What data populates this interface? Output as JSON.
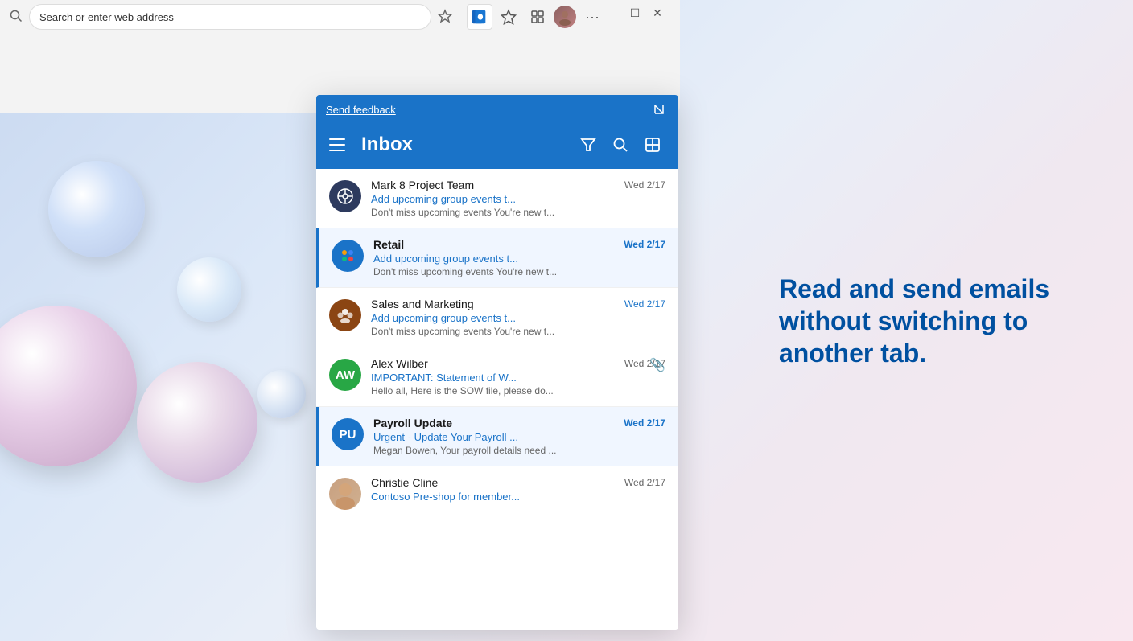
{
  "background": {
    "gradient": "linear-gradient(135deg, #c8d8f0, #dce8f8, #e8eef8, #f0e8f0, #f8e8f0)"
  },
  "browser": {
    "address_placeholder": "Search or enter web address",
    "window_controls": {
      "minimize": "—",
      "maximize": "☐",
      "close": "✕"
    }
  },
  "right_text": {
    "line1": "Read and send emails",
    "line2": "without switching to",
    "line3": "another tab."
  },
  "panel": {
    "feedback_label": "Send feedback",
    "title": "Inbox",
    "emails": [
      {
        "id": "mark8",
        "sender": "Mark 8 Project Team",
        "subject": "Add upcoming group events t...",
        "preview": "Don't miss upcoming events You're new t...",
        "date": "Wed 2/17",
        "avatar_initials": "",
        "avatar_class": "av-m8",
        "avatar_icon": "crosshair",
        "selected": false,
        "unread": false
      },
      {
        "id": "retail",
        "sender": "Retail",
        "subject": "Add upcoming group events t...",
        "preview": "Don't miss upcoming events You're new t...",
        "date": "Wed 2/17",
        "avatar_initials": "",
        "avatar_class": "av-retail",
        "avatar_icon": "dots-circle",
        "selected": true,
        "unread": true
      },
      {
        "id": "sales",
        "sender": "Sales and Marketing",
        "subject": "Add upcoming group events t...",
        "preview": "Don't miss upcoming events You're new t...",
        "date": "Wed 2/17",
        "avatar_initials": "",
        "avatar_class": "av-sm",
        "avatar_icon": "people",
        "selected": false,
        "unread": false
      },
      {
        "id": "alex",
        "sender": "Alex Wilber",
        "subject": "IMPORTANT: Statement of W...",
        "preview": "Hello all, Here is the SOW file, please do...",
        "date": "Wed 2/17",
        "avatar_initials": "AW",
        "avatar_class": "av-aw",
        "avatar_icon": "",
        "has_attachment": true,
        "selected": false,
        "unread": false
      },
      {
        "id": "payroll",
        "sender": "Payroll Update",
        "subject": "Urgent - Update Your Payroll ...",
        "preview": "Megan Bowen, Your payroll details need ...",
        "date": "Wed 2/17",
        "avatar_initials": "PU",
        "avatar_class": "av-pu",
        "avatar_icon": "",
        "selected": true,
        "unread": true
      },
      {
        "id": "christie",
        "sender": "Christie Cline",
        "subject": "Contoso Pre-shop for member...",
        "preview": "",
        "date": "Wed 2/17",
        "avatar_initials": "",
        "avatar_class": "av-cc",
        "avatar_icon": "person-photo",
        "selected": false,
        "unread": false
      }
    ]
  }
}
